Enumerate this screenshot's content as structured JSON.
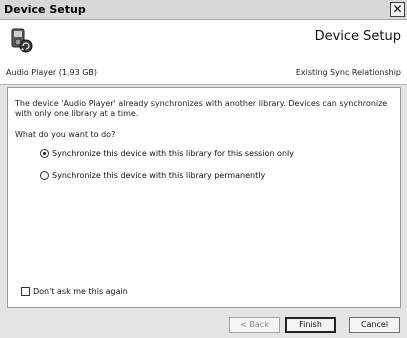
{
  "window": {
    "title": "Device Setup",
    "close_label": "✕"
  },
  "header": {
    "title": "Device Setup",
    "device_name": "Audio Player (1.93 GB)",
    "relationship": "Existing Sync Relationship",
    "icon": "device-sync-icon"
  },
  "body": {
    "description": "The device 'Audio Player' already synchronizes with another library. Devices can synchronize with only one library at a time.",
    "question": "What do you want to do?",
    "options": [
      {
        "label": "Synchronize this device with this library for this session only",
        "selected": true
      },
      {
        "label": "Synchronize this device with this library permanently",
        "selected": false
      }
    ],
    "dont_ask_label": "Don't ask me this again",
    "dont_ask_checked": false
  },
  "buttons": {
    "back": "< Back",
    "finish": "Finish",
    "cancel": "Cancel"
  }
}
